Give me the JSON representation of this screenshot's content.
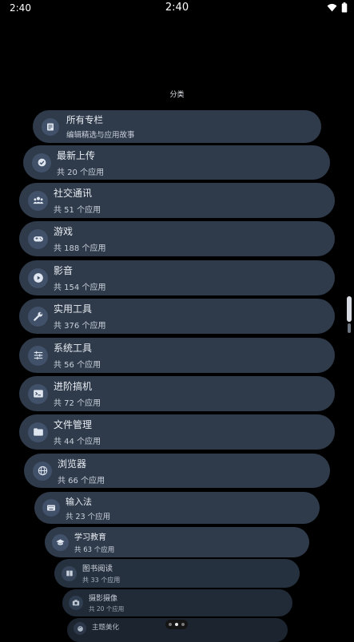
{
  "status_bar": {
    "time_left": "2:40",
    "time_center": "2:40"
  },
  "page": {
    "title": "分类"
  },
  "categories": [
    {
      "name": "所有专栏",
      "count": "编辑精选与应用故事",
      "icon": "article-icon"
    },
    {
      "name": "最新上传",
      "count": "共 20 个应用",
      "icon": "verified-badge-icon"
    },
    {
      "name": "社交通讯",
      "count": "共 51 个应用",
      "icon": "people-icon"
    },
    {
      "name": "游戏",
      "count": "共 188 个应用",
      "icon": "gamepad-icon"
    },
    {
      "name": "影音",
      "count": "共 154 个应用",
      "icon": "play-circle-icon"
    },
    {
      "name": "实用工具",
      "count": "共 376 个应用",
      "icon": "wrench-icon"
    },
    {
      "name": "系统工具",
      "count": "共 56 个应用",
      "icon": "sliders-icon"
    },
    {
      "name": "进阶搞机",
      "count": "共 72 个应用",
      "icon": "terminal-icon"
    },
    {
      "name": "文件管理",
      "count": "共 44 个应用",
      "icon": "folder-icon"
    },
    {
      "name": "浏览器",
      "count": "共 66 个应用",
      "icon": "globe-icon"
    },
    {
      "name": "输入法",
      "count": "共 23 个应用",
      "icon": "keyboard-icon"
    },
    {
      "name": "学习教育",
      "count": "共 63 个应用",
      "icon": "graduation-cap-icon"
    },
    {
      "name": "图书阅读",
      "count": "共 33 个应用",
      "icon": "book-icon"
    },
    {
      "name": "摄影摄像",
      "count": "共 20 个应用",
      "icon": "camera-icon"
    },
    {
      "name": "主题美化",
      "count": "",
      "icon": "palette-icon"
    }
  ]
}
